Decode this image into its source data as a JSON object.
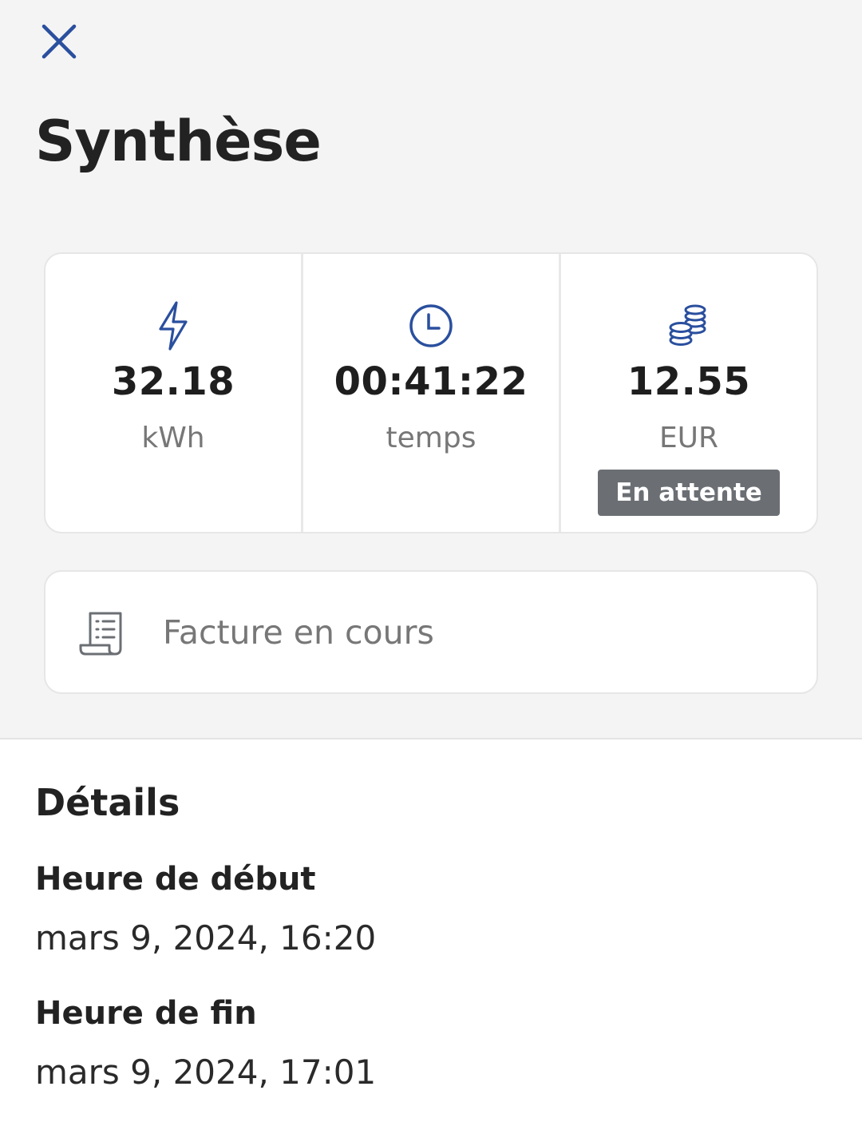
{
  "header": {
    "close_icon": "close-icon",
    "title": "Synthèse"
  },
  "stats": [
    {
      "icon": "lightning-icon",
      "value": "32.18",
      "unit": "kWh"
    },
    {
      "icon": "clock-icon",
      "value": "00:41:22",
      "unit": "temps"
    },
    {
      "icon": "coins-icon",
      "value": "12.55",
      "unit": "EUR",
      "badge": "En attente"
    }
  ],
  "invoice": {
    "icon": "receipt-icon",
    "label": "Facture en cours"
  },
  "details": {
    "title": "Détails",
    "start_label": "Heure de début",
    "start_value": "mars 9, 2024, 16:20",
    "end_label": "Heure de fin",
    "end_value": "mars 9, 2024, 17:01"
  },
  "colors": {
    "accent": "#2a4f9e",
    "badge_bg": "#6b6f74",
    "top_bg": "#f4f4f4"
  }
}
